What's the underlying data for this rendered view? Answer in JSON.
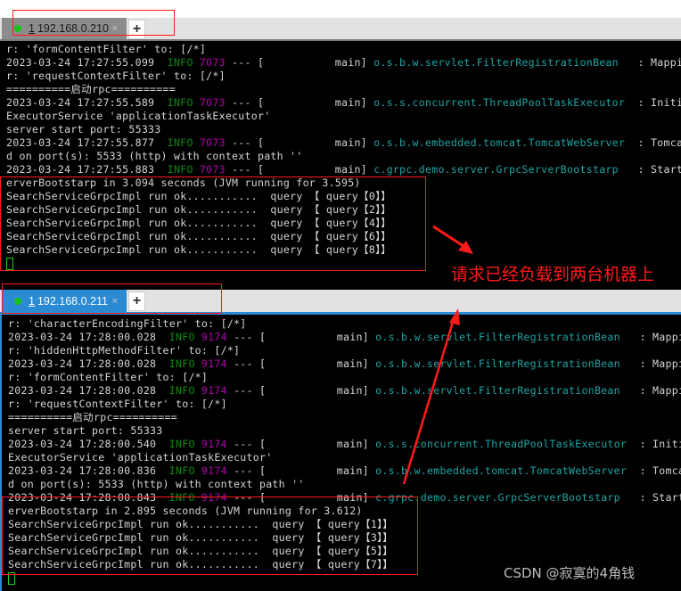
{
  "terminal_top": {
    "tab": {
      "index": "1",
      "host": "192.168.0.210",
      "close": "×",
      "status_color": "#19c219"
    },
    "add_tab": "+",
    "lines": [
      [
        {
          "t": "r: 'formContentFilter' to: [/*]"
        }
      ],
      [
        {
          "t": "2023-03-24 17:27:55.099  "
        },
        {
          "t": "INFO",
          "c": "info"
        },
        {
          "t": " "
        },
        {
          "t": "7073",
          "c": "pid"
        },
        {
          "t": " --- [           main] "
        },
        {
          "t": "o.s.b.w.servlet.FilterRegistrationBean",
          "c": "logger"
        },
        {
          "t": "   : Mapping f"
        }
      ],
      [
        {
          "t": "r: 'requestContextFilter' to: [/*]"
        }
      ],
      [
        {
          "t": "==========启动rpc=========="
        }
      ],
      [
        {
          "t": "2023-03-24 17:27:55.589  "
        },
        {
          "t": "INFO",
          "c": "info"
        },
        {
          "t": " "
        },
        {
          "t": "7073",
          "c": "pid"
        },
        {
          "t": " --- [           main] "
        },
        {
          "t": "o.s.s.concurrent.ThreadPoolTaskExecutor",
          "c": "logger"
        },
        {
          "t": "  : Initiali"
        }
      ],
      [
        {
          "t": "ExecutorService 'applicationTaskExecutor'"
        }
      ],
      [
        {
          "t": "server start port: 55333"
        }
      ],
      [
        {
          "t": "2023-03-24 17:27:55.877  "
        },
        {
          "t": "INFO",
          "c": "info"
        },
        {
          "t": " "
        },
        {
          "t": "7073",
          "c": "pid"
        },
        {
          "t": " --- [           main] "
        },
        {
          "t": "o.s.b.w.embedded.tomcat.TomcatWebServer",
          "c": "logger"
        },
        {
          "t": "  : Tomcat st"
        }
      ],
      [
        {
          "t": "d on port(s): 5533 (http) with context path ''"
        }
      ],
      [
        {
          "t": "2023-03-24 17:27:55.883  "
        },
        {
          "t": "INFO",
          "c": "info"
        },
        {
          "t": " "
        },
        {
          "t": "7073",
          "c": "pid"
        },
        {
          "t": " --- [           main] "
        },
        {
          "t": "c.grpc.demo.server.GrpcServerBootstarp",
          "c": "logger"
        },
        {
          "t": "   : Started G"
        }
      ],
      [
        {
          "t": "erverBootstarp in 3.094 seconds (JVM running for 3.595)"
        }
      ],
      [
        {
          "t": "SearchServiceGrpcImpl run ok...........  query 【 query【0】】"
        }
      ],
      [
        {
          "t": "SearchServiceGrpcImpl run ok...........  query 【 query【2】】"
        }
      ],
      [
        {
          "t": "SearchServiceGrpcImpl run ok...........  query 【 query【4】】"
        }
      ],
      [
        {
          "t": "SearchServiceGrpcImpl run ok...........  query 【 query【6】】"
        }
      ],
      [
        {
          "t": "SearchServiceGrpcImpl run ok...........  query 【 query【8】】"
        }
      ]
    ]
  },
  "terminal_bottom": {
    "tab": {
      "index": "1",
      "host": "192.168.0.211",
      "close": "×",
      "status_color": "#19c219"
    },
    "add_tab": "+",
    "lines": [
      [
        {
          "t": "r: 'characterEncodingFilter' to: [/*]"
        }
      ],
      [
        {
          "t": "2023-03-24 17:28:00.028  "
        },
        {
          "t": "INFO",
          "c": "info"
        },
        {
          "t": " "
        },
        {
          "t": "9174",
          "c": "pid"
        },
        {
          "t": " --- [           main] "
        },
        {
          "t": "o.s.b.w.servlet.FilterRegistrationBean",
          "c": "logger"
        },
        {
          "t": "   : Mapping f"
        }
      ],
      [
        {
          "t": "r: 'hiddenHttpMethodFilter' to: [/*]"
        }
      ],
      [
        {
          "t": "2023-03-24 17:28:00.028  "
        },
        {
          "t": "INFO",
          "c": "info"
        },
        {
          "t": " "
        },
        {
          "t": "9174",
          "c": "pid"
        },
        {
          "t": " --- [           main] "
        },
        {
          "t": "o.s.b.w.servlet.FilterRegistrationBean",
          "c": "logger"
        },
        {
          "t": "   : Mapping f"
        }
      ],
      [
        {
          "t": "r: 'formContentFilter' to: [/*]"
        }
      ],
      [
        {
          "t": "2023-03-24 17:28:00.028  "
        },
        {
          "t": "INFO",
          "c": "info"
        },
        {
          "t": " "
        },
        {
          "t": "9174",
          "c": "pid"
        },
        {
          "t": " --- [           main] "
        },
        {
          "t": "o.s.b.w.servlet.FilterRegistrationBean",
          "c": "logger"
        },
        {
          "t": "   : Mapping f"
        }
      ],
      [
        {
          "t": "r: 'requestContextFilter' to: [/*]"
        }
      ],
      [
        {
          "t": "==========启动rpc=========="
        }
      ],
      [
        {
          "t": "server start port: 55333"
        }
      ],
      [
        {
          "t": "2023-03-24 17:28:00.540  "
        },
        {
          "t": "INFO",
          "c": "info"
        },
        {
          "t": " "
        },
        {
          "t": "9174",
          "c": "pid"
        },
        {
          "t": " --- [           main] "
        },
        {
          "t": "o.s.s.concurrent.ThreadPoolTaskExecutor",
          "c": "logger"
        },
        {
          "t": "  : Initiali"
        }
      ],
      [
        {
          "t": "ExecutorService 'applicationTaskExecutor'"
        }
      ],
      [
        {
          "t": "2023-03-24 17:28:00.836  "
        },
        {
          "t": "INFO",
          "c": "info"
        },
        {
          "t": " "
        },
        {
          "t": "9174",
          "c": "pid"
        },
        {
          "t": " --- [           main] "
        },
        {
          "t": "o.s.b.w.embedded.tomcat.TomcatWebServer",
          "c": "logger"
        },
        {
          "t": "  : Tomcat st"
        }
      ],
      [
        {
          "t": "d on port(s): 5533 (http) with context path ''"
        }
      ],
      [
        {
          "t": "2023-03-24 17:28:00.843  "
        },
        {
          "t": "INFO",
          "c": "info"
        },
        {
          "t": " "
        },
        {
          "t": "9174",
          "c": "pid"
        },
        {
          "t": " --- [           main] "
        },
        {
          "t": "c.grpc.demo.server.GrpcServerBootstarp",
          "c": "logger"
        },
        {
          "t": "   : Started G"
        }
      ],
      [
        {
          "t": "erverBootstarp in 2.895 seconds (JVM running for 3.612)"
        }
      ],
      [
        {
          "t": "SearchServiceGrpcImpl run ok...........  query 【 query【1】】"
        }
      ],
      [
        {
          "t": "SearchServiceGrpcImpl run ok...........  query 【 query【3】】"
        }
      ],
      [
        {
          "t": "SearchServiceGrpcImpl run ok...........  query 【 query【5】】"
        }
      ],
      [
        {
          "t": "SearchServiceGrpcImpl run ok...........  query 【 query【7】】"
        }
      ]
    ]
  },
  "annotation": {
    "text": "请求已经负载到两台机器上",
    "color": "#ff1a1a"
  },
  "watermark": "CSDN @寂寞的4角钱"
}
